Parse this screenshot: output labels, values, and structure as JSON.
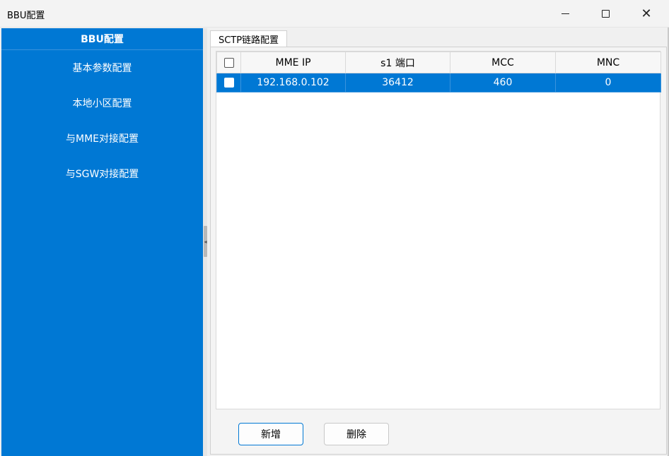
{
  "window": {
    "title": "BBU配置",
    "minimize_icon": "minimize-icon",
    "maximize_icon": "maximize-icon",
    "close_icon": "close-icon",
    "close_glyph": "✕"
  },
  "sidebar": {
    "header": "BBU配置",
    "items": [
      {
        "label": "基本参数配置"
      },
      {
        "label": "本地小区配置"
      },
      {
        "label": "与MME对接配置"
      },
      {
        "label": "与SGW对接配置"
      }
    ]
  },
  "tabs": [
    {
      "label": "SCTP链路配置",
      "active": true
    }
  ],
  "table": {
    "columns": [
      "",
      "MME IP",
      "s1 端口",
      "MCC",
      "MNC"
    ],
    "rows": [
      {
        "checked": false,
        "selected": true,
        "mme_ip": "192.168.0.102",
        "s1_port": "36412",
        "mcc": "460",
        "mnc": "0"
      }
    ]
  },
  "buttons": {
    "add": "新增",
    "delete": "删除"
  },
  "colors": {
    "accent": "#0078d4",
    "sidebar_text": "#ffffff",
    "selected_row": "#0078d4"
  }
}
